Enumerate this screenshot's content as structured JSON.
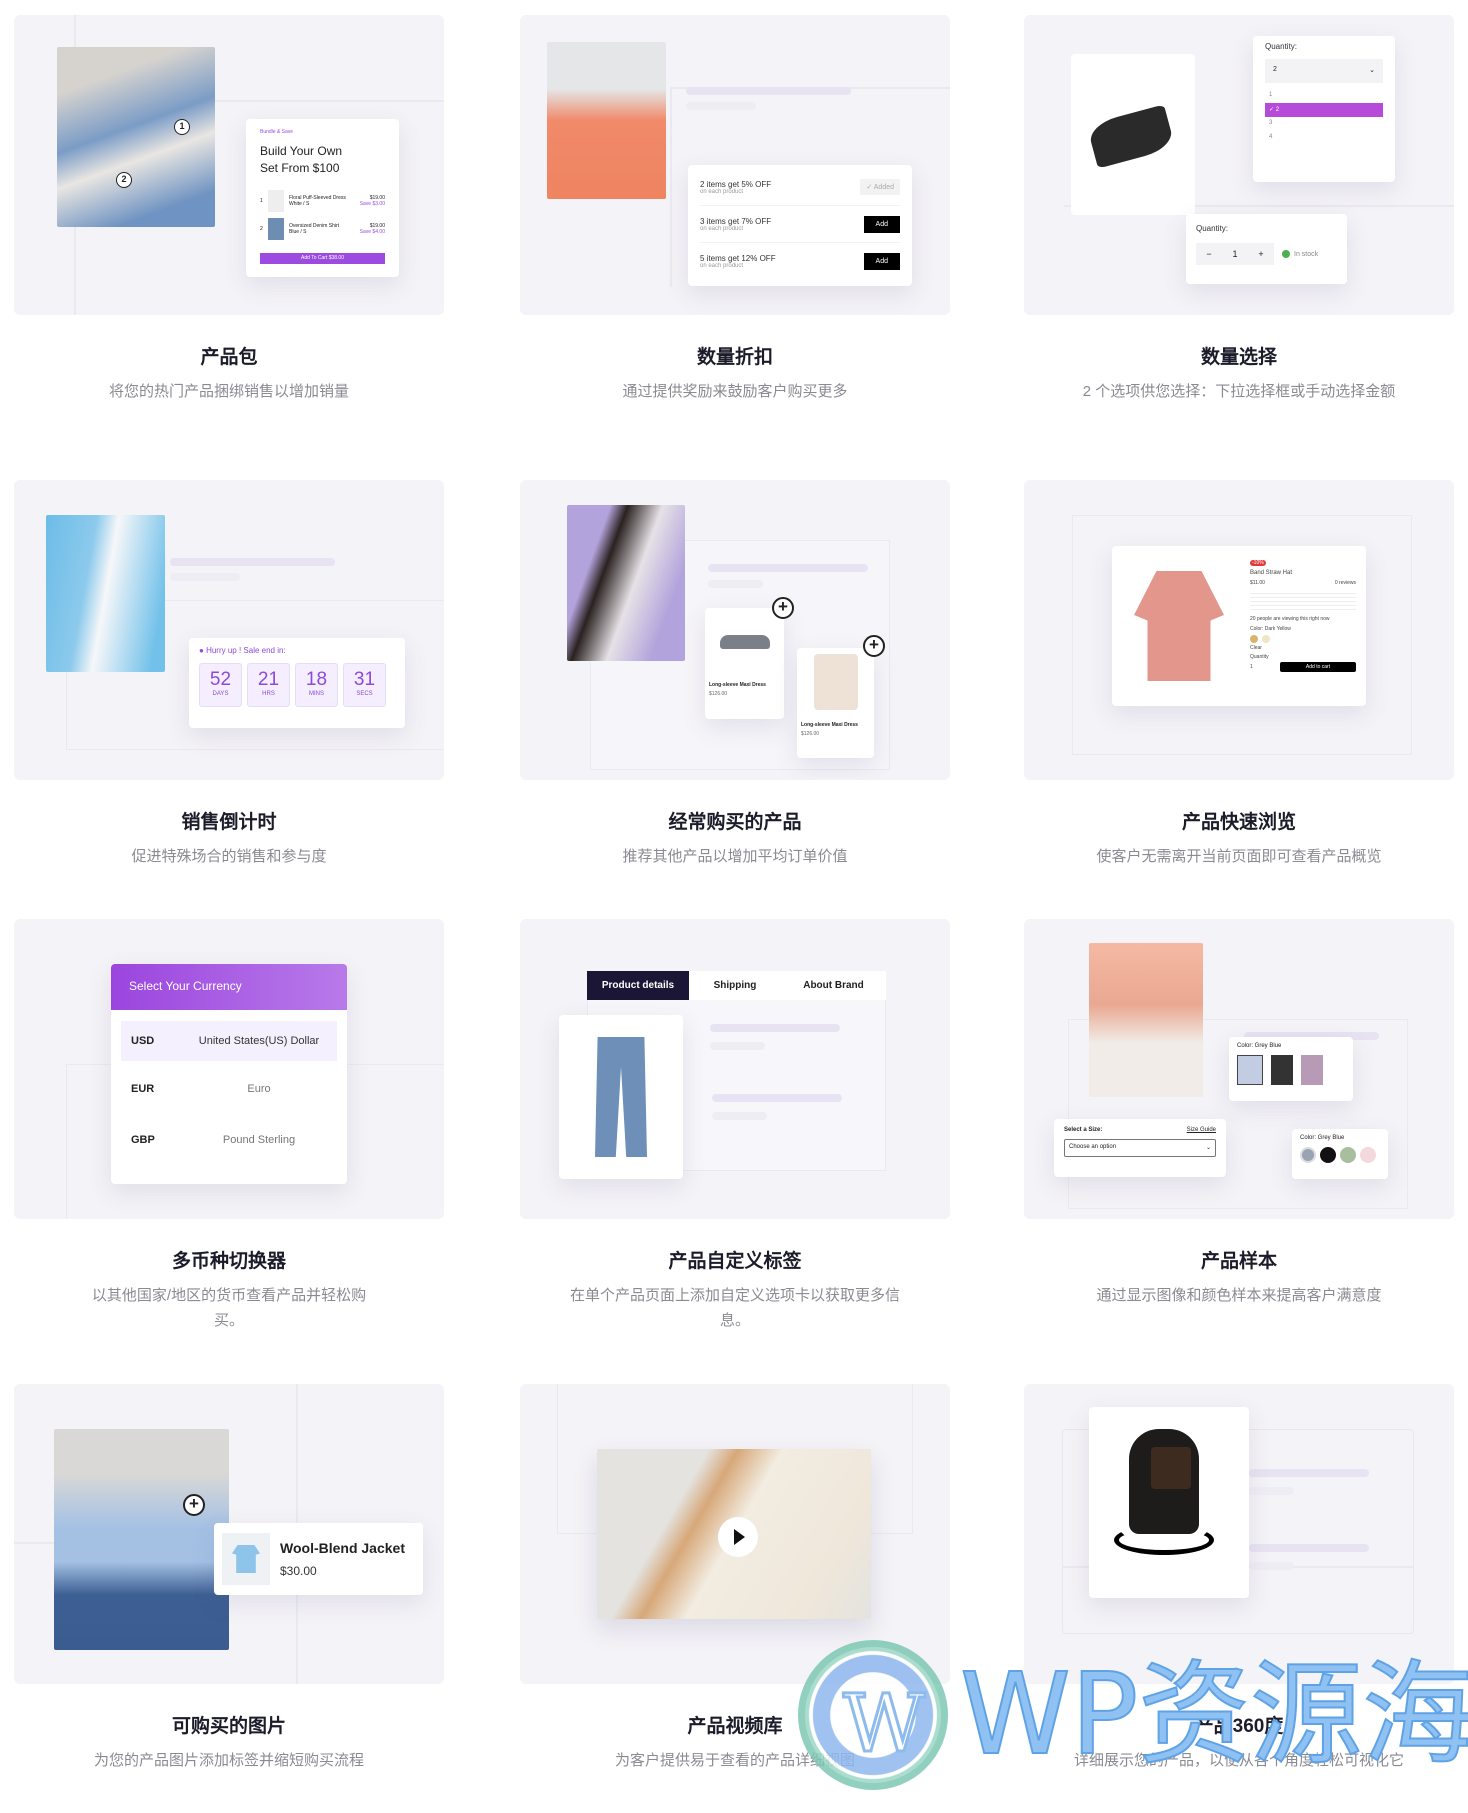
{
  "features": [
    {
      "title": "产品包",
      "desc": "将您的热门产品捆绑销售以增加销量",
      "mock": {
        "tag": "Bundle & Save",
        "heading_line1": "Build Your Own",
        "heading_line2": "Set From $100",
        "items": [
          {
            "num": "1",
            "name": "Floral Puff-Sleeved Dress",
            "variant": "White / S",
            "price": "$19.00",
            "save": "Save $3.00"
          },
          {
            "num": "2",
            "name": "Oversized Denim Shirt",
            "variant": "Blue / S",
            "price": "$19.00",
            "save": "Save $4.00"
          }
        ],
        "hotspots": [
          "1",
          "2"
        ],
        "cta": "Add To Cart   $38.00"
      }
    },
    {
      "title": "数量折扣",
      "desc": "通过提供奖励来鼓励客户购买更多",
      "mock": {
        "tiers": [
          {
            "label": "2 items get 5% OFF",
            "sub": "on each product",
            "action": "✓ Added"
          },
          {
            "label": "3 items get 7% OFF",
            "sub": "on each product",
            "action": "Add"
          },
          {
            "label": "5 items get 12% OFF",
            "sub": "on each product",
            "action": "Add"
          }
        ]
      }
    },
    {
      "title": "数量选择",
      "desc": "2 个选项供您选择：下拉选择框或手动选择金额",
      "mock": {
        "quantity_label": "Quantity:",
        "dropdown_value": "2",
        "options": [
          "1",
          "✓ 2",
          "3",
          "4"
        ],
        "stepper_value": "1",
        "minus": "−",
        "plus": "+",
        "stock": "In stock"
      }
    },
    {
      "title": "销售倒计时",
      "desc": "促进特殊场合的销售和参与度",
      "mock": {
        "hurry": "Hurry up ! Sale end in:",
        "units": [
          {
            "value": "52",
            "label": "DAYS"
          },
          {
            "value": "21",
            "label": "HRS"
          },
          {
            "value": "18",
            "label": "MINS"
          },
          {
            "value": "31",
            "label": "SECS"
          }
        ]
      }
    },
    {
      "title": "经常购买的产品",
      "desc": "推荐其他产品以增加平均订单价值",
      "mock": {
        "products": [
          {
            "name": "Long-sleeve Maxi Dress",
            "price": "$126.00"
          },
          {
            "name": "Long-sleeve Maxi Dress",
            "price": "$126.00"
          }
        ]
      }
    },
    {
      "title": "产品快速浏览",
      "desc": "使客户无需离开当前页面即可查看产品概览",
      "mock": {
        "badge": "-10%",
        "name": "Band Straw Hat",
        "price": "$11.00",
        "reviews": "0 reviews",
        "viewing": "20 people are viewing this right now",
        "color_label": "Color: Dark Yellow",
        "clear": "Clear",
        "qty_label": "Quantity",
        "qty": "1",
        "add": "Add to cart"
      }
    },
    {
      "title": "多币种切换器",
      "desc": "以其他国家/地区的货币查看产品并轻松购买。",
      "mock": {
        "header": "Select Your Currency",
        "currencies": [
          {
            "code": "USD",
            "name": "United States(US) Dollar"
          },
          {
            "code": "EUR",
            "name": "Euro"
          },
          {
            "code": "GBP",
            "name": "Pound Sterling"
          }
        ]
      }
    },
    {
      "title": "产品自定义标签",
      "desc": "在单个产品页面上添加自定义选项卡以获取更多信息。",
      "mock": {
        "tabs": [
          "Product details",
          "Shipping",
          "About Brand"
        ],
        "active_tab": "Product details"
      }
    },
    {
      "title": "产品样本",
      "desc": "通过显示图像和颜色样本来提高客户满意度",
      "mock": {
        "color_label": "Color:  Grey Blue",
        "size_label": "Select a Size:",
        "size_guide": "Size Guide",
        "size_placeholder": "Choose an option",
        "color_label2": "Color:  Grey Blue",
        "swatches": [
          "#9aa3b3",
          "#111111",
          "#a8bf9f",
          "#f3d9de"
        ]
      }
    },
    {
      "title": "可购买的图片",
      "desc": "为您的产品图片添加标签并缩短购买流程",
      "mock": {
        "name": "Wool-Blend Jacket",
        "price": "$30.00"
      }
    },
    {
      "title": "产品视频库",
      "desc": "为客户提供易于查看的产品详细视图",
      "mock": {}
    },
    {
      "title": "产品360度",
      "desc": "详细展示您的产品，以便从各个角度轻松可视化它",
      "mock": {}
    }
  ],
  "watermark": {
    "text": "WP资源海"
  },
  "colors": {
    "accent": "#9b4be0",
    "card_bg": "#f4f3f7",
    "title": "#1b1b2a",
    "desc": "#8a8a92"
  }
}
